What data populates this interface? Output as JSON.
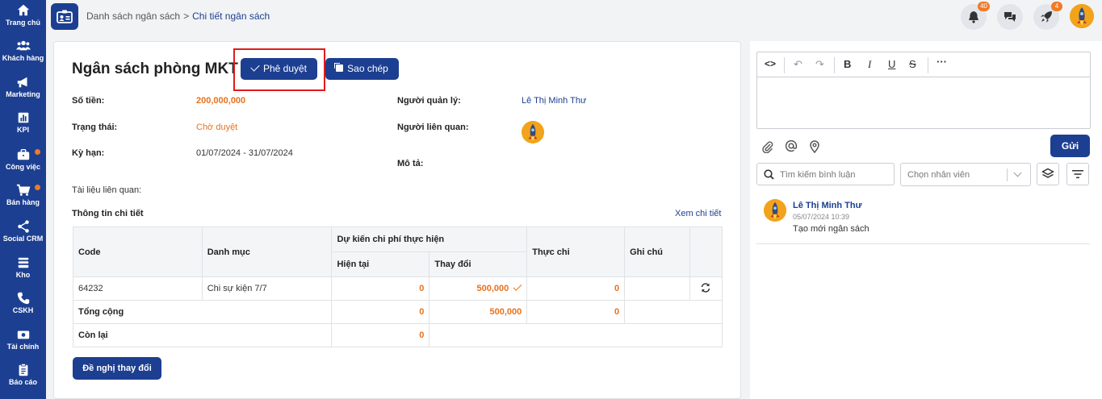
{
  "sidebar": {
    "items": [
      {
        "label": "Trang chủ",
        "icon": "home-icon"
      },
      {
        "label": "Khách hàng",
        "icon": "users-icon"
      },
      {
        "label": "Marketing",
        "icon": "megaphone-icon"
      },
      {
        "label": "KPI",
        "icon": "chart-icon"
      },
      {
        "label": "Công việc",
        "icon": "briefcase-icon"
      },
      {
        "label": "Bán hàng",
        "icon": "cart-icon"
      },
      {
        "label": "Social CRM",
        "icon": "share-icon"
      },
      {
        "label": "Kho",
        "icon": "warehouse-icon"
      },
      {
        "label": "CSKH",
        "icon": "phone-icon"
      },
      {
        "label": "Tài chính",
        "icon": "money-icon"
      },
      {
        "label": "Báo cáo",
        "icon": "clipboard-icon"
      }
    ]
  },
  "header": {
    "breadcrumb": {
      "parent": "Danh sách ngân sách",
      "current": "Chi tiết ngân sách"
    },
    "notifications_count": "40",
    "rocket_count": "4"
  },
  "detail": {
    "title": "Ngân sách phòng MKT",
    "approve_label": "Phê duyệt",
    "copy_label": "Sao chép",
    "amount_label": "Số tiền:",
    "amount": "200,000,000",
    "status_label": "Trạng thái:",
    "status": "Chờ duyệt",
    "period_label": "Kỳ hạn:",
    "period": "01/07/2024 - 31/07/2024",
    "manager_label": "Người quản lý:",
    "manager": "Lê Thị Minh Thư",
    "related_label": "Người liên quan:",
    "desc_label": "Mô tả:",
    "docs_label": "Tài liệu liên quan:",
    "section_title": "Thông tin chi tiết",
    "view_detail": "Xem chi tiết",
    "propose_change": "Đề nghị thay đổi"
  },
  "table": {
    "headers": {
      "code": "Code",
      "category": "Danh mục",
      "planned": "Dự kiến chi phí thực hiện",
      "current": "Hiện tại",
      "change": "Thay đổi",
      "actual": "Thực chi",
      "note": "Ghi chú"
    },
    "row": {
      "code": "64232",
      "category": "Chi sự kiện 7/7",
      "current": "0",
      "change": "500,000",
      "actual": "0",
      "note": ""
    },
    "total": {
      "label": "Tổng cộng",
      "current": "0",
      "change": "500,000",
      "actual": "0"
    },
    "remaining": {
      "label": "Còn lại",
      "current": "0"
    }
  },
  "comments": {
    "send_label": "Gửi",
    "search_placeholder": "Tìm kiếm bình luận",
    "select_placeholder": "Chọn nhân viên",
    "items": [
      {
        "author": "Lê Thị Minh Thư",
        "time": "05/07/2024 10:39",
        "text": "Tạo mới ngân sách"
      }
    ]
  },
  "colors": {
    "brand": "#1c3f91",
    "accent": "#e8711a",
    "highlight": "#e01b1b"
  }
}
